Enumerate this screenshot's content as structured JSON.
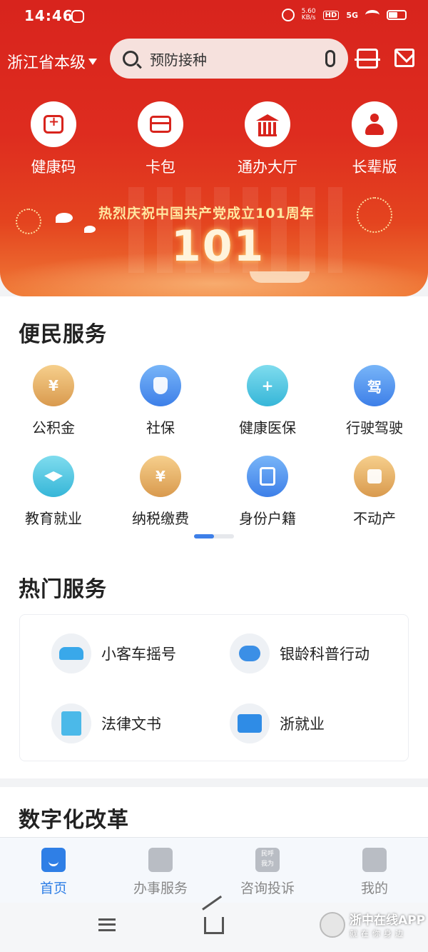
{
  "status_bar": {
    "time": "14:46",
    "net_speed_value": "5.60",
    "net_speed_unit": "KB/s",
    "hd_label": "HD",
    "network": "5G"
  },
  "header": {
    "region": "浙江省本级",
    "search_placeholder": "预防接种"
  },
  "top_apps": [
    {
      "label": "健康码",
      "icon": "health-code-icon"
    },
    {
      "label": "卡包",
      "icon": "card-wallet-icon"
    },
    {
      "label": "通办大厅",
      "icon": "service-hall-icon"
    },
    {
      "label": "长辈版",
      "icon": "elder-mode-icon"
    }
  ],
  "banner": {
    "headline": "热烈庆祝中国共产党成立101周年",
    "number": "101"
  },
  "convenience": {
    "title": "便民服务",
    "items": [
      {
        "label": "公积金",
        "glyph": "¥"
      },
      {
        "label": "社保",
        "glyph": ""
      },
      {
        "label": "健康医保",
        "glyph": "+"
      },
      {
        "label": "行驶驾驶",
        "glyph": "驾"
      },
      {
        "label": "教育就业",
        "glyph": ""
      },
      {
        "label": "纳税缴费",
        "glyph": "¥"
      },
      {
        "label": "身份户籍",
        "glyph": ""
      },
      {
        "label": "不动产",
        "glyph": ""
      }
    ]
  },
  "hot": {
    "title": "热门服务",
    "items": [
      {
        "label": "小客车摇号"
      },
      {
        "label": "银龄科普行动"
      },
      {
        "label": "法律文书"
      },
      {
        "label": "浙就业"
      }
    ]
  },
  "digital": {
    "title": "数字化改革"
  },
  "tabbar": {
    "tabs": [
      {
        "label": "首页",
        "active": true
      },
      {
        "label": "办事服务"
      },
      {
        "label": "咨询投诉",
        "icon_text_1": "民呼",
        "icon_text_2": "我为"
      },
      {
        "label": "我的"
      }
    ]
  },
  "watermark": {
    "title": "浙中在线APP",
    "subtitle": "就在你身边"
  },
  "colors": {
    "hero_red": "#d8241d",
    "accent_blue": "#2f7fe6"
  }
}
